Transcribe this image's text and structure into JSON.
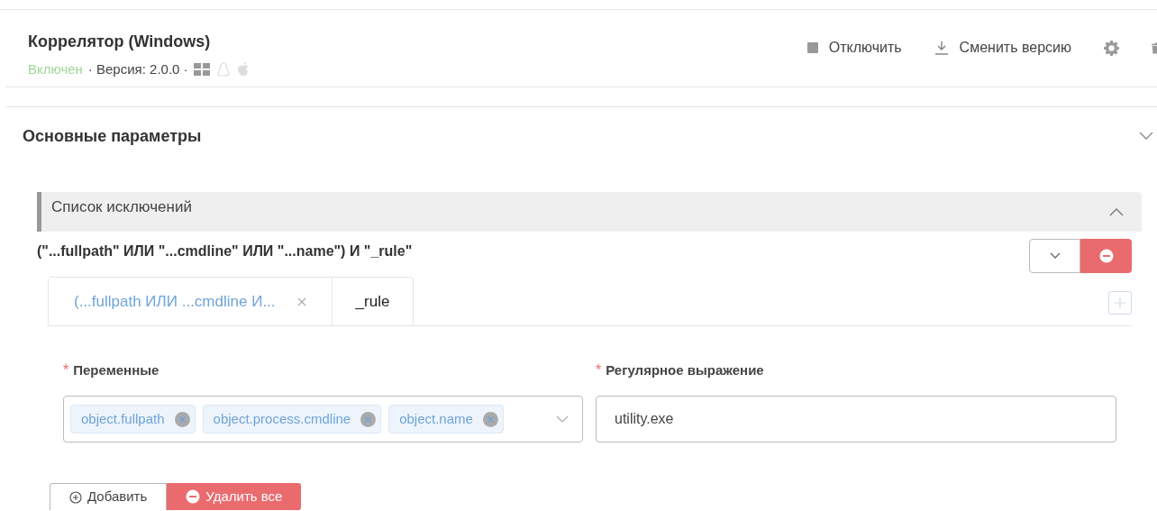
{
  "header": {
    "title": "Коррелятор (Windows)",
    "status": "Включен",
    "version": "· Версия: 2.0.0 ·",
    "platforms": [
      {
        "kind": "windows",
        "active": true
      },
      {
        "kind": "linux",
        "active": false
      },
      {
        "kind": "apple",
        "active": false
      }
    ],
    "actions": [
      {
        "kind": "stop",
        "label": "Отключить"
      },
      {
        "kind": "download",
        "label": "Сменить версию"
      }
    ]
  },
  "section": {
    "title": "Основные параметры"
  },
  "panel": {
    "title": "Список исключений",
    "expanded": true,
    "expression": "(\"...fullpath\" ИЛИ \"...cmdline\" ИЛИ \"...name\") И \"_rule\"",
    "tabs": [
      {
        "label": "(...fullpath ИЛИ ...cmdline И...",
        "selected": true
      },
      {
        "label": "_rule",
        "selected": false
      }
    ],
    "variables": {
      "required_mark": "*",
      "label": "Переменные",
      "tags": [
        "object.fullpath",
        "object.process.cmdline",
        "object.name"
      ]
    },
    "regex": {
      "required_mark": "*",
      "label": "Регулярное выражение",
      "value": "utility.exe"
    }
  },
  "buttons": [
    {
      "kind": "add",
      "label": "Добавить"
    },
    {
      "kind": "delete",
      "label": "Удалить все"
    }
  ]
}
